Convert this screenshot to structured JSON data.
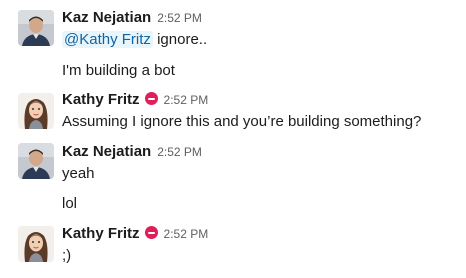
{
  "messages": [
    {
      "author": "Kaz Nejatian",
      "time": "2:52 PM",
      "dnd": false,
      "lines": [
        {
          "mention": "@Kathy Fritz",
          "text": " ignore.."
        },
        {
          "text": "I'm building a bot"
        }
      ]
    },
    {
      "author": "Kathy Fritz",
      "time": "2:52 PM",
      "dnd": true,
      "lines": [
        {
          "text": "Assuming I ignore this and you’re building something?"
        }
      ]
    },
    {
      "author": "Kaz Nejatian",
      "time": "2:52 PM",
      "dnd": false,
      "lines": [
        {
          "text": "yeah"
        },
        {
          "text": "lol"
        }
      ]
    },
    {
      "author": "Kathy Fritz",
      "time": "2:52 PM",
      "dnd": true,
      "lines": [
        {
          "text": ";)"
        }
      ]
    }
  ],
  "icons": {
    "status": "do-not-disturb-icon"
  },
  "colors": {
    "mention_bg": "#e8f5fa",
    "mention_text": "#1264a3",
    "dnd": "#e01e5a"
  }
}
